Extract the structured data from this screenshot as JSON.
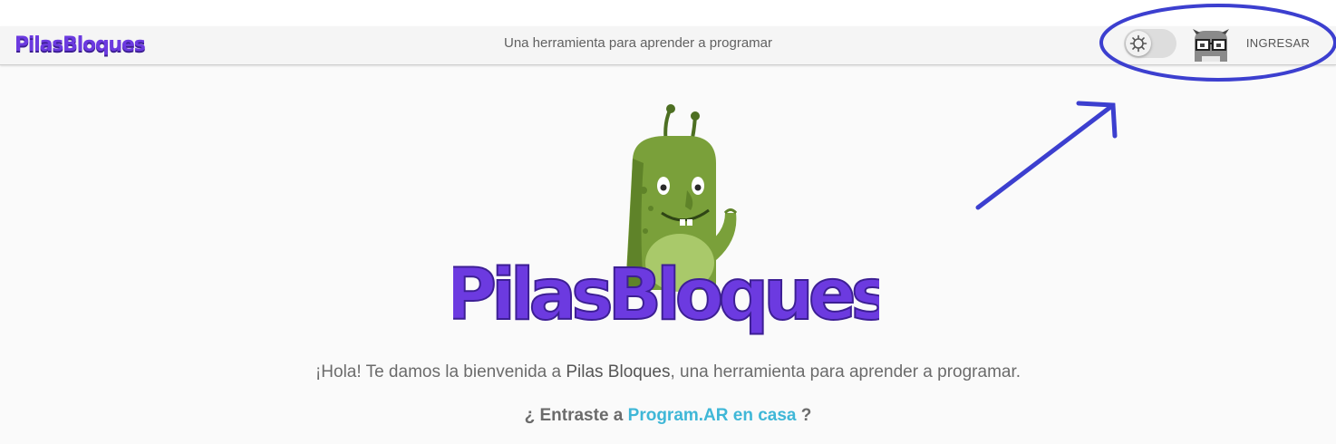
{
  "navbar": {
    "brand": "PilasBloques",
    "tagline": "Una herramienta para aprender a programar",
    "theme_toggle_icon": "gear-icon",
    "login_label": "INGRESAR"
  },
  "hero": {
    "logo_text": "PilasBloques"
  },
  "welcome": {
    "before": "¡Hola! Te damos la bienvenida a ",
    "name": "Pilas Bloques",
    "after": ", una herramienta para aprender a programar."
  },
  "question": {
    "before": "¿ Entraste a ",
    "link": "Program.AR en casa",
    "after": " ?"
  },
  "colors": {
    "brand_purple": "#6c3ae0",
    "link_cyan": "#3fb7d7",
    "annotation_blue": "#3c3fcf",
    "monster_green": "#7aa03a"
  }
}
